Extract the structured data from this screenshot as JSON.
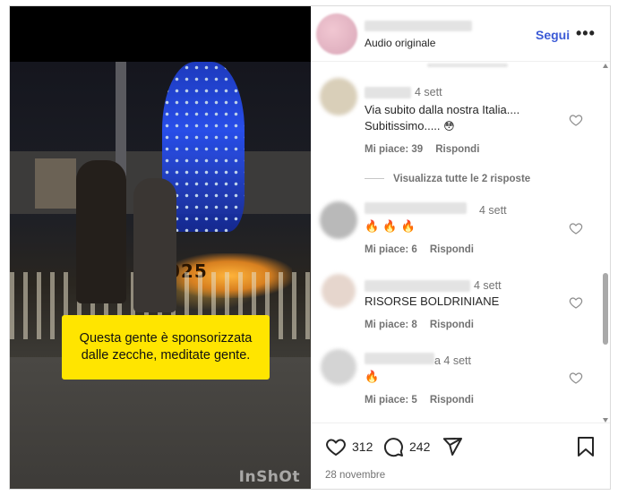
{
  "video": {
    "caption": "Questa gente è sponsorizzata dalle zecche, meditate gente.",
    "watermark": "InShOt",
    "scene_text": "025"
  },
  "header": {
    "audio_label": "Audio originale",
    "follow_label": "Segui",
    "more_label": "•••"
  },
  "comments": [
    {
      "time": "4 sett",
      "text_line1": "Via subito dalla nostra Italia....",
      "text_line2": "Subitissimo.....",
      "emoji": "😳",
      "likes": "Mi piace: 39",
      "reply": "Rispondi",
      "view_replies": "Visualizza tutte le 2 risposte"
    },
    {
      "time": "4 sett",
      "text_line1": "🔥 🔥 🔥",
      "likes": "Mi piace: 6",
      "reply": "Rispondi"
    },
    {
      "time": "4 sett",
      "text_line1": "RISORSE BOLDRINIANE",
      "likes": "Mi piace: 8",
      "reply": "Rispondi"
    },
    {
      "time": "a 4 sett",
      "text_line1": "🔥",
      "likes": "Mi piace: 5",
      "reply": "Rispondi"
    }
  ],
  "actions": {
    "likes_count": "312",
    "comments_count": "242",
    "date": "28 novembre"
  },
  "colors": {
    "accent": "#3b5ad6",
    "caption_bg": "#ffe500",
    "muted_text": "#737373"
  },
  "icons": [
    "more-icon",
    "heart-icon",
    "comment-icon",
    "share-icon",
    "save-icon"
  ]
}
